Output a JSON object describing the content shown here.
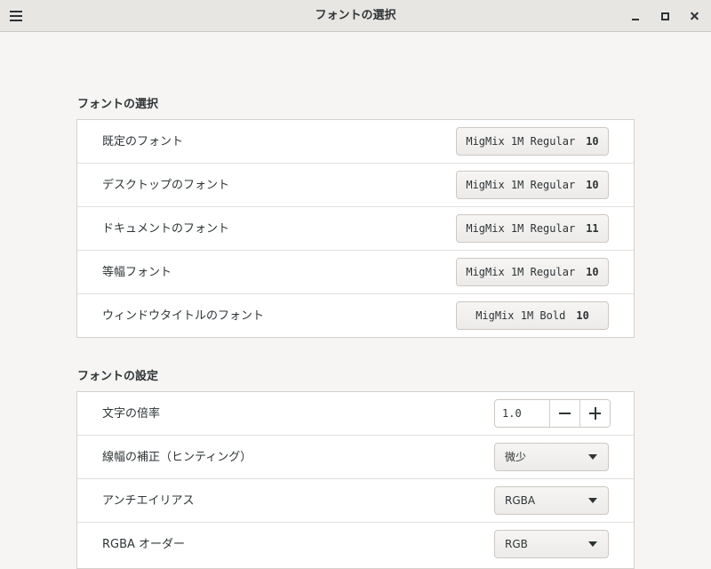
{
  "window": {
    "title": "フォントの選択"
  },
  "section_fonts": {
    "heading": "フォントの選択",
    "rows": [
      {
        "label": "既定のフォント",
        "font": "MigMix 1M Regular",
        "size": "10"
      },
      {
        "label": "デスクトップのフォント",
        "font": "MigMix 1M Regular",
        "size": "10"
      },
      {
        "label": "ドキュメントのフォント",
        "font": "MigMix 1M Regular",
        "size": "11"
      },
      {
        "label": "等幅フォント",
        "font": "MigMix 1M Regular",
        "size": "10"
      },
      {
        "label": "ウィンドウタイトルのフォント",
        "font": "MigMix 1M Bold",
        "size": "10"
      }
    ]
  },
  "section_settings": {
    "heading": "フォントの設定",
    "scale": {
      "label": "文字の倍率",
      "value": "1.0"
    },
    "hinting": {
      "label": "線幅の補正（ヒンティング）",
      "value": "微少"
    },
    "antialias": {
      "label": "アンチエイリアス",
      "value": "RGBA"
    },
    "rgba_order": {
      "label": "RGBA オーダー",
      "value": "RGB"
    }
  },
  "icons": [
    "hamburger-menu-icon",
    "minimize-icon",
    "maximize-icon",
    "close-icon",
    "minus-icon",
    "plus-icon",
    "chevron-down-icon"
  ]
}
